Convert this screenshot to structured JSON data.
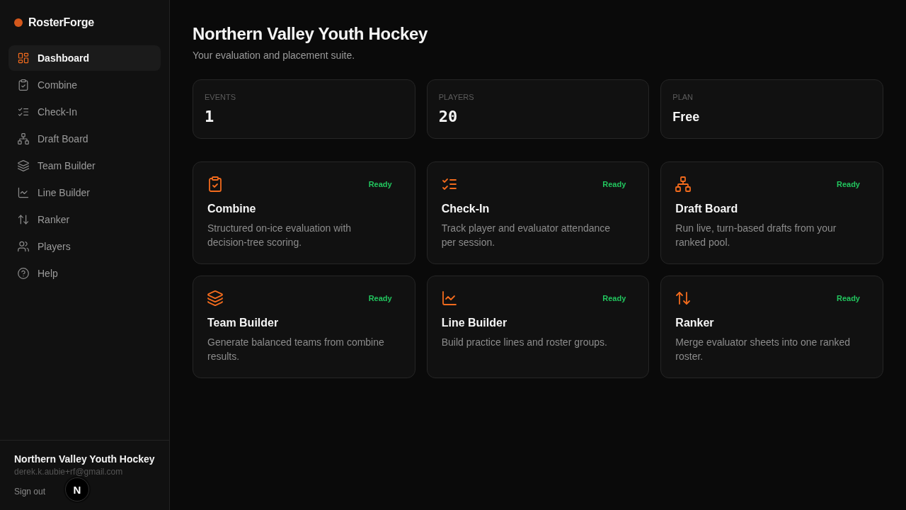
{
  "sidebar": {
    "brand": "RosterForge",
    "nav": [
      {
        "label": "Dashboard",
        "kind": "dashboard",
        "selected": true
      },
      {
        "label": "Combine",
        "kind": "combine",
        "selected": false
      },
      {
        "label": "Check-In",
        "kind": "checkin",
        "selected": false
      },
      {
        "label": "Draft Board",
        "kind": "draft",
        "selected": false
      },
      {
        "label": "Team Builder",
        "kind": "teams",
        "selected": false
      },
      {
        "label": "Line Builder",
        "kind": "lines",
        "selected": false
      },
      {
        "label": "Ranker",
        "kind": "ranker",
        "selected": false
      },
      {
        "label": "Players",
        "kind": "players",
        "selected": false
      },
      {
        "label": "Help",
        "kind": "help",
        "selected": false
      }
    ],
    "footer": {
      "organization": "Northern Valley Youth Hockey",
      "email": "derek.k.aubie+rf@gmail.com",
      "sign_out": "Sign out"
    }
  },
  "main": {
    "title": "Northern Valley Youth Hockey",
    "subtitle": "Your evaluation and placement suite.",
    "stats": [
      {
        "label": "EVENTS",
        "value": "1",
        "kind": "number"
      },
      {
        "label": "PLAYERS",
        "value": "20",
        "kind": "number"
      },
      {
        "label": "PLAN",
        "value": "Free",
        "kind": "text"
      }
    ],
    "tools": [
      {
        "title": "Combine",
        "kind": "combine",
        "status": "Ready",
        "description": "Structured on-ice evaluation with decision-tree scoring."
      },
      {
        "title": "Check-In",
        "kind": "checkin",
        "status": "Ready",
        "description": "Track player and evaluator attendance per session."
      },
      {
        "title": "Draft Board",
        "kind": "draft",
        "status": "Ready",
        "description": "Run live, turn-based drafts from your ranked pool."
      },
      {
        "title": "Team Builder",
        "kind": "teams",
        "status": "Ready",
        "description": "Generate balanced teams from combine results."
      },
      {
        "title": "Line Builder",
        "kind": "lines",
        "status": "Ready",
        "description": "Build practice lines and roster groups."
      },
      {
        "title": "Ranker",
        "kind": "ranker",
        "status": "Ready",
        "description": "Merge evaluator sheets into one ranked roster."
      }
    ]
  },
  "dev_tools_badge": "N"
}
